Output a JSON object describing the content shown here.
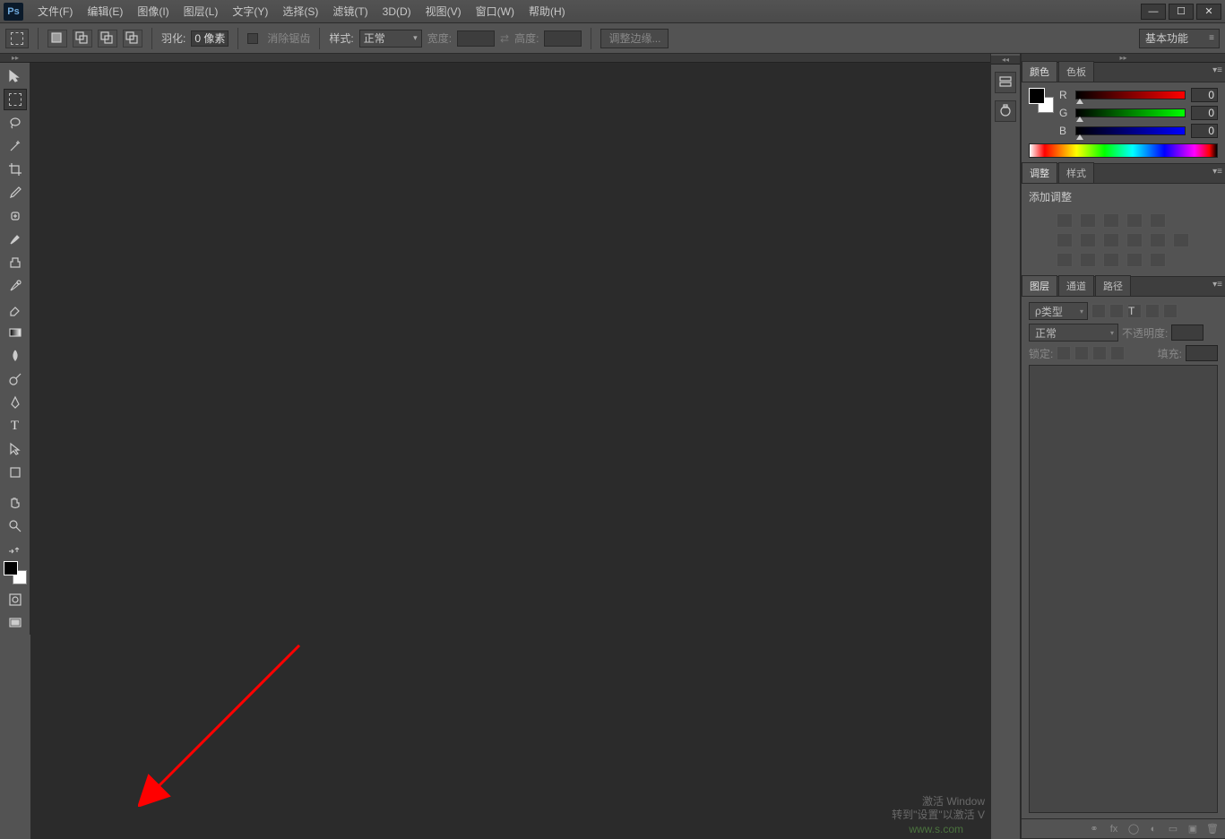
{
  "app": {
    "logo": "Ps"
  },
  "menu": {
    "file": "文件(F)",
    "edit": "编辑(E)",
    "image": "图像(I)",
    "layer": "图层(L)",
    "type": "文字(Y)",
    "select": "选择(S)",
    "filter": "滤镜(T)",
    "threeD": "3D(D)",
    "view": "视图(V)",
    "window": "窗口(W)",
    "help": "帮助(H)"
  },
  "options": {
    "feather_label": "羽化:",
    "feather_value": "0 像素",
    "antialias": "消除锯齿",
    "style_label": "样式:",
    "style_value": "正常",
    "width_label": "宽度:",
    "height_label": "高度:",
    "refine_edge": "调整边缘...",
    "workspace": "基本功能"
  },
  "tools": [
    "move",
    "marquee",
    "lasso",
    "magic-wand",
    "crop",
    "eyedropper",
    "healing",
    "brush",
    "clone",
    "history-brush",
    "eraser",
    "gradient",
    "blur",
    "dodge",
    "pen",
    "type",
    "path-select",
    "shape",
    "hand",
    "zoom"
  ],
  "tool_extras": [
    "swap-colors",
    "quickmask",
    "screen-mode"
  ],
  "dock_icons": [
    "history",
    "properties"
  ],
  "color_panel": {
    "tab_color": "颜色",
    "tab_swatches": "色板",
    "r_label": "R",
    "g_label": "G",
    "b_label": "B",
    "r": "0",
    "g": "0",
    "b": "0"
  },
  "adjust_panel": {
    "tab_adjust": "调整",
    "tab_styles": "样式",
    "heading": "添加调整"
  },
  "layers_panel": {
    "tab_layers": "图层",
    "tab_channels": "通道",
    "tab_paths": "路径",
    "kind_label": "类型",
    "search_prefix": "ρ",
    "blend_mode": "正常",
    "opacity_label": "不透明度:",
    "lock_label": "锁定:",
    "fill_label": "填充:",
    "footer_icons": [
      "link",
      "fx",
      "mask",
      "adjust",
      "group",
      "new",
      "trash"
    ]
  },
  "watermark": {
    "line1": "激活 Window",
    "line2": "转到\"设置\"以激活 V",
    "wm2": "www.s.com"
  }
}
